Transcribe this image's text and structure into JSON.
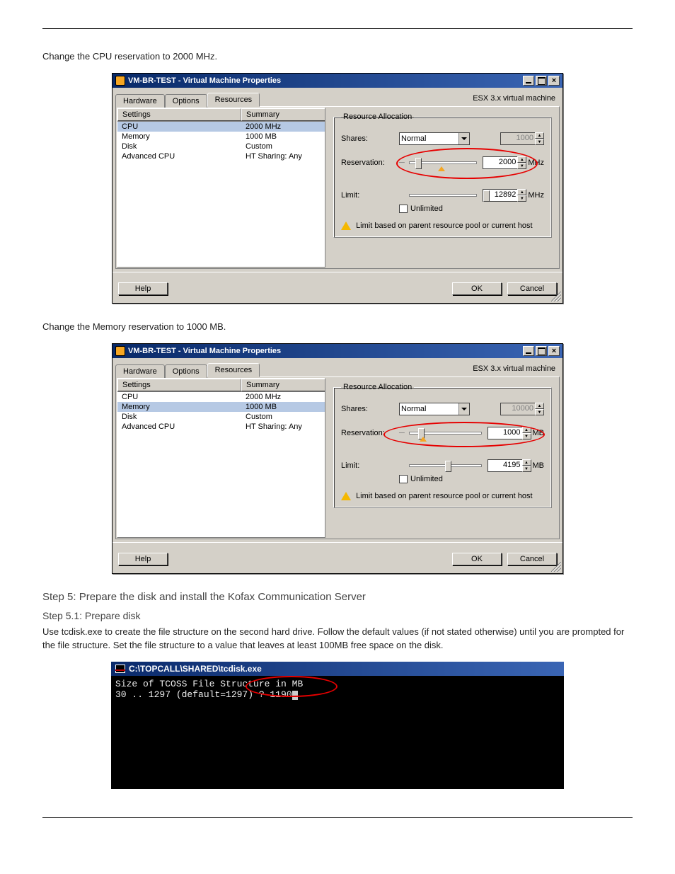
{
  "page": {
    "intro": "Change the CPU reservation to 2000 MHz.",
    "memory_intro": "Change the Memory reservation to 1000 MB.",
    "section5_title": "Step 5: Prepare the disk and install the Kofax Communication Server",
    "step5_1_title": "Step 5.1: Prepare disk",
    "step5_1_body": "Use tcdisk.exe to create the file structure on the second hard drive. Follow the default values (if not stated otherwise) until you are prompted for the file structure. Set the file structure to a value that leaves at least 100MB free space on the disk."
  },
  "dialog_cpu": {
    "title": "VM-BR-TEST - Virtual Machine Properties",
    "esx": "ESX 3.x virtual machine",
    "tabs": [
      "Hardware",
      "Options",
      "Resources"
    ],
    "active_tab": 2,
    "list_headers": [
      "Settings",
      "Summary"
    ],
    "rows": [
      {
        "name": "CPU",
        "summary": "2000 MHz"
      },
      {
        "name": "Memory",
        "summary": "1000 MB"
      },
      {
        "name": "Disk",
        "summary": "Custom"
      },
      {
        "name": "Advanced CPU",
        "summary": "HT Sharing: Any"
      }
    ],
    "selected_row": 0,
    "group_label": "Resource Allocation",
    "shares_label": "Shares:",
    "shares_value": "Normal",
    "shares_num": "1000",
    "reservation_label": "Reservation:",
    "reservation_value": "2000",
    "reservation_unit": "MHz",
    "limit_label": "Limit:",
    "limit_value": "12892",
    "limit_unit": "MHz",
    "unlimited_label": "Unlimited",
    "warning": "Limit based on parent resource pool or current host",
    "help": "Help",
    "ok": "OK",
    "cancel": "Cancel"
  },
  "dialog_mem": {
    "title": "VM-BR-TEST - Virtual Machine Properties",
    "esx": "ESX 3.x virtual machine",
    "tabs": [
      "Hardware",
      "Options",
      "Resources"
    ],
    "active_tab": 2,
    "list_headers": [
      "Settings",
      "Summary"
    ],
    "rows": [
      {
        "name": "CPU",
        "summary": "2000 MHz"
      },
      {
        "name": "Memory",
        "summary": "1000 MB"
      },
      {
        "name": "Disk",
        "summary": "Custom"
      },
      {
        "name": "Advanced CPU",
        "summary": "HT Sharing: Any"
      }
    ],
    "selected_row": 1,
    "group_label": "Resource Allocation",
    "shares_label": "Shares:",
    "shares_value": "Normal",
    "shares_num": "10000",
    "reservation_label": "Reservation:",
    "reservation_value": "1000",
    "reservation_unit": "MB",
    "limit_label": "Limit:",
    "limit_value": "4195",
    "limit_unit": "MB",
    "unlimited_label": "Unlimited",
    "warning": "Limit based on parent resource pool or current host",
    "help": "Help",
    "ok": "OK",
    "cancel": "Cancel"
  },
  "console": {
    "title": "C:\\TOPCALL\\SHARED\\tcdisk.exe",
    "line1": "Size of TCOSS File Structure in MB",
    "line2": "30 .. 1297 (default=1297) ? 1190"
  }
}
